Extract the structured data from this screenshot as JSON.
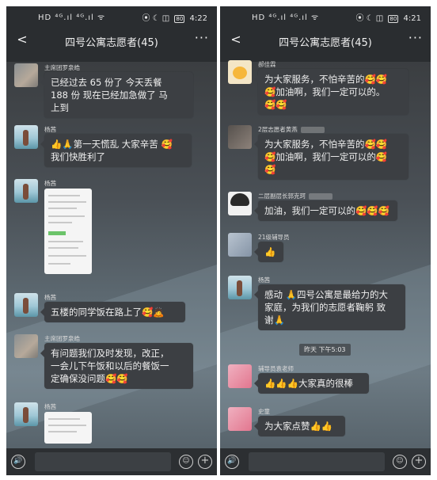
{
  "left": {
    "status": {
      "time": "4:22",
      "signal": "HD ⁴ᴳ.ıl ⁴ᴳ.ıl ᯤ",
      "icons": "⦿ ☾ ◫",
      "battery": "80"
    },
    "header": {
      "back": "<",
      "title": "四号公寓志愿者(45)",
      "more": "···"
    },
    "messages": [
      {
        "sender": "主席团罗泉皓",
        "lines": [
          "已经过去 65 份了  今天丢餐",
          "188 份  现在已经加急做了 马",
          "上到"
        ]
      },
      {
        "sender": "杨茜",
        "lines": [
          "👍🙏第一天慌乱 大家辛苦 🥰",
          "我们快胜利了"
        ]
      },
      {
        "sender": "杨茜"
      },
      {
        "sender": "杨茜",
        "lines": [
          "五楼的同学饭在路上了🥰🙇"
        ]
      },
      {
        "sender": "主席团罗泉皓",
        "lines": [
          "有问题我们及时发现，改正，",
          "一会儿下午饭和以后的餐饭一",
          "定确保没问题🥰🥰"
        ]
      },
      {
        "sender": "杨茜"
      }
    ]
  },
  "right": {
    "status": {
      "time": "4:21",
      "signal": "HD ⁴ᴳ.ıl ⁴ᴳ.ıl ᯤ",
      "icons": "⦿ ☾ ◫",
      "battery": "80"
    },
    "header": {
      "back": "<",
      "title": "四号公寓志愿者(45)",
      "more": "···"
    },
    "messages": [
      {
        "sender": "郝佳霖",
        "lines": [
          "为大家服务，不怕辛苦的🥰🥰",
          "🥰加油啊，我们一定可以的。",
          "🥰🥰"
        ]
      },
      {
        "sender": "2层志愿者黄燕",
        "lines": [
          "为大家服务，不怕辛苦的🥰🥰",
          "🥰加油啊，我们一定可以的🥰",
          "🥰"
        ]
      },
      {
        "sender": "二层副层长郭克珂",
        "lines": [
          "加油，我们一定可以的🥰🥰🥰"
        ]
      },
      {
        "sender": "21级辅导员",
        "lines": [
          "👍"
        ]
      },
      {
        "sender": "杨茜",
        "lines": [
          "感动 🙏四号公寓是最给力的大",
          "家庭，为我们的志愿者鞠躬 致",
          "谢🙏"
        ]
      },
      {
        "timestamp": "昨天 下午5:03"
      },
      {
        "sender": "辅导员袁老师",
        "lines": [
          "👍👍👍大家真的很棒"
        ]
      },
      {
        "sender": "史童",
        "lines": [
          "为大家点赞👍👍"
        ]
      }
    ]
  },
  "input": {
    "voice_icon": "🔊",
    "emoji_icon": "☺",
    "plus_icon": "+"
  }
}
